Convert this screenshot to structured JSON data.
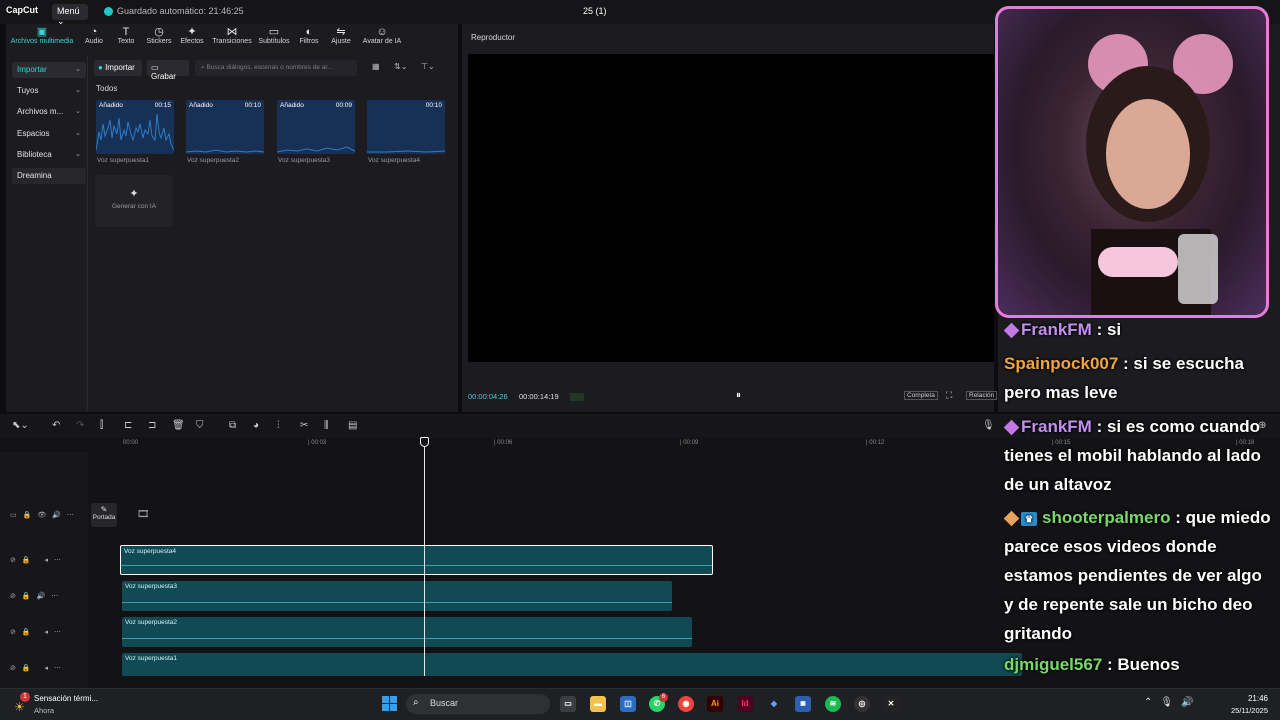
{
  "titlebar": {
    "logo": "CapCut",
    "menu": "Menú ⌄",
    "autosave": "Guardado automático: 21:46:25",
    "project_title": "25 (1)"
  },
  "tabs": [
    {
      "label": "Archivos multimedia",
      "icon": "media-icon",
      "glyph": "▣"
    },
    {
      "label": "Audio",
      "icon": "audio-icon",
      "glyph": "◔"
    },
    {
      "label": "Texto",
      "icon": "text-icon",
      "glyph": "T"
    },
    {
      "label": "Stickers",
      "icon": "sticker-icon",
      "glyph": "◷"
    },
    {
      "label": "Efectos",
      "icon": "effects-icon",
      "glyph": "✦"
    },
    {
      "label": "Transiciones",
      "icon": "transitions-icon",
      "glyph": "⋈"
    },
    {
      "label": "Subtítulos",
      "icon": "subtitles-icon",
      "glyph": "▭"
    },
    {
      "label": "Filtros",
      "icon": "filters-icon",
      "glyph": "◐"
    },
    {
      "label": "Ajuste",
      "icon": "adjust-icon",
      "glyph": "⇋"
    },
    {
      "label": "Avatar de IA",
      "icon": "avatar-icon",
      "glyph": "☺"
    }
  ],
  "side_nav": [
    {
      "label": "Importar"
    },
    {
      "label": "Tuyos"
    },
    {
      "label": "Archivos m..."
    },
    {
      "label": "Espacios"
    },
    {
      "label": "Biblioteca"
    },
    {
      "label": "Dreamina"
    }
  ],
  "media": {
    "import_label": "Importar",
    "record_label": "Grabar",
    "search_placeholder": "Busca diálogos, escenas o nombres de ar...",
    "all_label": "Todos",
    "items": [
      {
        "tag": "Añadido",
        "duration": "00:15",
        "name": "Voz superpuesta1"
      },
      {
        "tag": "Añadido",
        "duration": "00:10",
        "name": "Voz superpuesta2"
      },
      {
        "tag": "Añadido",
        "duration": "00:09",
        "name": "Voz superpuesta3"
      },
      {
        "tag": "",
        "duration": "00:10",
        "name": "Voz superpuesta4"
      }
    ],
    "generate_ai": "Generar con IA"
  },
  "player": {
    "title": "Reproductor",
    "time_current": "00:00:04:26",
    "time_total": "00:00:14:19",
    "complete_label": "Completa",
    "ratio_label": "Relación"
  },
  "timeline": {
    "ticks": [
      "00:00",
      "| 00:03",
      "| 00:06",
      "| 00:09",
      "| 00:12",
      "| 00:15",
      "| 00:18"
    ],
    "cover_label": "Portada",
    "clips": [
      {
        "name": "Voz superpuesta4"
      },
      {
        "name": "Voz superpuesta3"
      },
      {
        "name": "Voz superpuesta2"
      },
      {
        "name": "Voz superpuesta1"
      }
    ]
  },
  "chat": [
    {
      "user": "FrankFM",
      "badge": "gem",
      "text": " : si"
    },
    {
      "user": "Spainpock007",
      "badge": "",
      "text": " : si se escucha pero mas leve"
    },
    {
      "user": "FrankFM",
      "badge": "gem",
      "text": " : si es como cuando tienes el mobil hablando al lado de un altavoz"
    },
    {
      "user": "shooterpalmero",
      "badge": "diamond-crown",
      "text": " : que miedo parece esos videos donde estamos pendientes de ver algo y de repente sale un bicho deo gritando"
    },
    {
      "user": "djmiguel567",
      "badge": "",
      "text": " : Buenos"
    }
  ],
  "taskbar": {
    "weather_badge": "1",
    "weather_title": "Sensación térmi...",
    "weather_sub": "Ahora",
    "search_label": "Buscar",
    "whatsapp_badge": "6",
    "clock_time": "21:46",
    "clock_date": "25/11/2025"
  },
  "colors": {
    "accent": "#38d5d5",
    "webcam_border": "#e77cd8",
    "clip": "#0f4a55"
  }
}
